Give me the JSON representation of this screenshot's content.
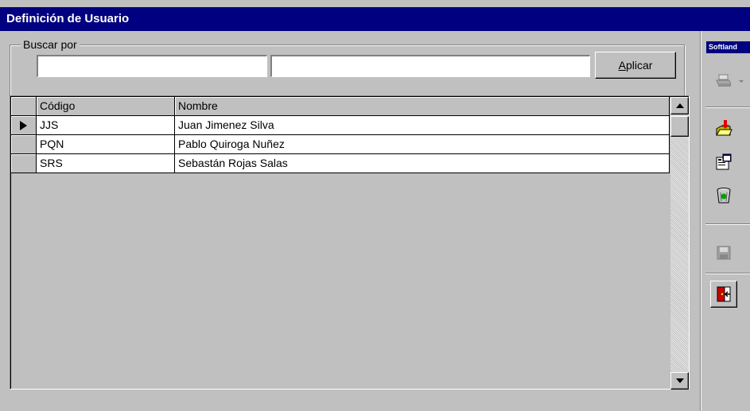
{
  "window": {
    "title": "Definición de Usuario"
  },
  "search": {
    "group_label": "Buscar por",
    "field1_value": "",
    "field2_value": "",
    "apply_label_accel": "A",
    "apply_label_rest": "plicar"
  },
  "grid": {
    "columns": [
      "Código",
      "Nombre"
    ],
    "rows": [
      {
        "codigo": "JJS",
        "nombre": "Juan Jimenez Silva",
        "current": true
      },
      {
        "codigo": "PQN",
        "nombre": "Pablo Quiroga Nuñez",
        "current": false
      },
      {
        "codigo": "SRS",
        "nombre": "Sebastán Rojas Salas",
        "current": false
      }
    ]
  },
  "toolbar": {
    "logo_text": "Softland",
    "icons": [
      "print-icon",
      "new-record-icon",
      "properties-icon",
      "delete-icon",
      "save-icon",
      "exit-icon"
    ],
    "accent_colors": {
      "title_bar": "#000080",
      "exit_red": "#cc0000"
    }
  }
}
